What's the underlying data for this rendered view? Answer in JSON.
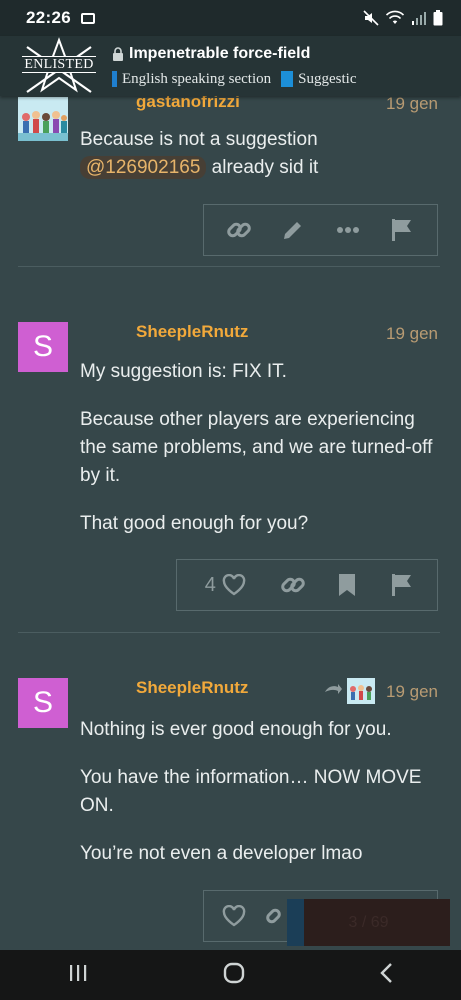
{
  "status_bar": {
    "time": "22:26"
  },
  "header": {
    "logo_text": "ENLISTED",
    "title": "Impenetrable force-field",
    "categories": [
      {
        "label": "English speaking section"
      },
      {
        "label": "Suggestic"
      }
    ]
  },
  "posts": [
    {
      "username": "gastanofrizzi",
      "date": "19 gen",
      "paragraphs": [
        {
          "before": "Because is not a suggestion",
          "mention": "@126902165",
          "after": "already sid it"
        }
      ]
    },
    {
      "username": "SheepleRnutz",
      "avatar_letter": "S",
      "date": "19 gen",
      "paragraphs": [
        "My suggestion is: FIX IT.",
        "Because other players are experiencing the same problems, and we are turned-off by it.",
        "That good enough for you?"
      ],
      "like_count": "4"
    },
    {
      "username": "SheepleRnutz",
      "avatar_letter": "S",
      "date": "19 gen",
      "paragraphs": [
        "Nothing is ever good enough for you.",
        "You have the information… NOW MOVE ON.",
        "You’re not even a developer lmao"
      ]
    }
  ],
  "overlay_text": "3 / 69",
  "colors": {
    "background": "#36474a",
    "header": "#263436",
    "username": "#f2a93b",
    "date": "#b89b73",
    "avatar": "#cf5fd2",
    "category_swatch": "#1f7fcf"
  },
  "icons": {
    "actions_post1": [
      "link-icon",
      "pencil-icon",
      "more-icon",
      "flag-icon"
    ],
    "actions_post2": [
      "heart-icon",
      "link-icon",
      "bookmark-icon",
      "flag-icon"
    ],
    "actions_post3": [
      "heart-icon",
      "link-icon"
    ],
    "nav": [
      "recents-icon",
      "home-icon",
      "back-icon"
    ]
  }
}
